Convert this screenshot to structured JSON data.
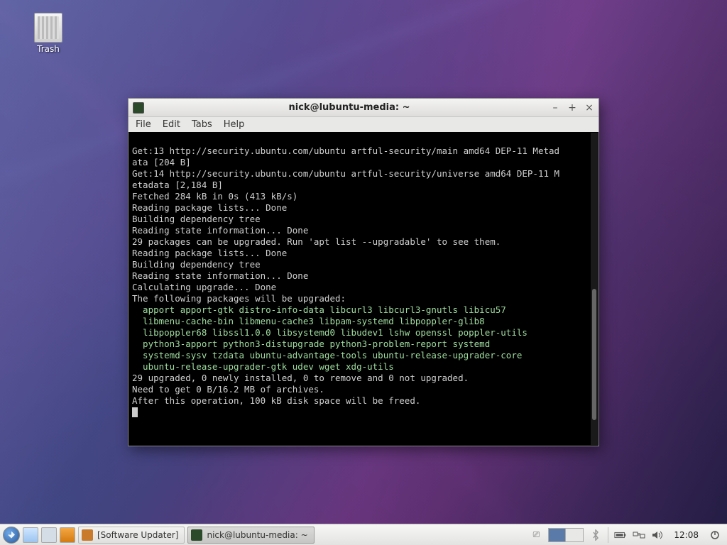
{
  "desktop": {
    "trash_label": "Trash"
  },
  "window": {
    "title": "nick@lubuntu-media: ~",
    "menu": {
      "file": "File",
      "edit": "Edit",
      "tabs": "Tabs",
      "help": "Help"
    }
  },
  "terminal": {
    "lines": [
      "Get:13 http://security.ubuntu.com/ubuntu artful-security/main amd64 DEP-11 Metad",
      "ata [204 B]",
      "Get:14 http://security.ubuntu.com/ubuntu artful-security/universe amd64 DEP-11 M",
      "etadata [2,184 B]",
      "Fetched 284 kB in 0s (413 kB/s)",
      "Reading package lists... Done",
      "Building dependency tree",
      "Reading state information... Done",
      "29 packages can be upgraded. Run 'apt list --upgradable' to see them.",
      "Reading package lists... Done",
      "Building dependency tree",
      "Reading state information... Done",
      "Calculating upgrade... Done",
      "The following packages will be upgraded:",
      "  apport apport-gtk distro-info-data libcurl3 libcurl3-gnutls libicu57",
      "  libmenu-cache-bin libmenu-cache3 libpam-systemd libpoppler-glib8",
      "  libpoppler68 libssl1.0.0 libsystemd0 libudev1 lshw openssl poppler-utils",
      "  python3-apport python3-distupgrade python3-problem-report systemd",
      "  systemd-sysv tzdata ubuntu-advantage-tools ubuntu-release-upgrader-core",
      "  ubuntu-release-upgrader-gtk udev wget xdg-utils",
      "29 upgraded, 0 newly installed, 0 to remove and 0 not upgraded.",
      "Need to get 0 B/16.2 MB of archives.",
      "After this operation, 100 kB disk space will be freed."
    ]
  },
  "taskbar": {
    "task1": "[Software Updater]",
    "task2": "nick@lubuntu-media: ~",
    "clock": "12:08"
  }
}
